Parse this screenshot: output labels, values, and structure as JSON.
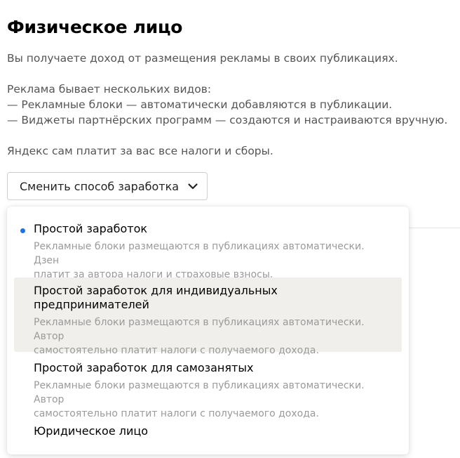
{
  "header": {
    "title": "Физическое лицо"
  },
  "description": {
    "line1": "Вы получаете доход от размещения рекламы в своих публикациях.",
    "line2": "Реклама бывает нескольких видов:",
    "line3": "— Рекламные блоки — автоматически добавляются в публикации.",
    "line4": "— Виджеты партнёрских программ — создаются и настраиваются вручную.",
    "line5": "Яндекс сам платит за вас все налоги и сборы."
  },
  "change_button": {
    "label": "Сменить способ заработка",
    "icon": "chevron-down-icon"
  },
  "dropdown": {
    "selected_index": 0,
    "hovered_index": 1,
    "accent_color": "#1a73e8",
    "options": [
      {
        "name": "Простой заработок",
        "sub1": "Рекламные блоки размещаются в публикациях автоматически. Дзен",
        "sub2": "платит за автора налоги и страховые взносы."
      },
      {
        "name1": "Простой заработок для индивидуальных",
        "name2": "предпринимателей",
        "sub1": "Рекламные блоки размещаются в публикациях автоматически. Автор",
        "sub2": "самостоятельно платит налоги с получаемого дохода."
      },
      {
        "name": "Простой заработок для самозанятых",
        "sub1": "Рекламные блоки размещаются в публикациях автоматически. Автор",
        "sub2": "самостоятельно платит налоги с получаемого дохода."
      },
      {
        "name": "Юридическое лицо"
      }
    ]
  }
}
